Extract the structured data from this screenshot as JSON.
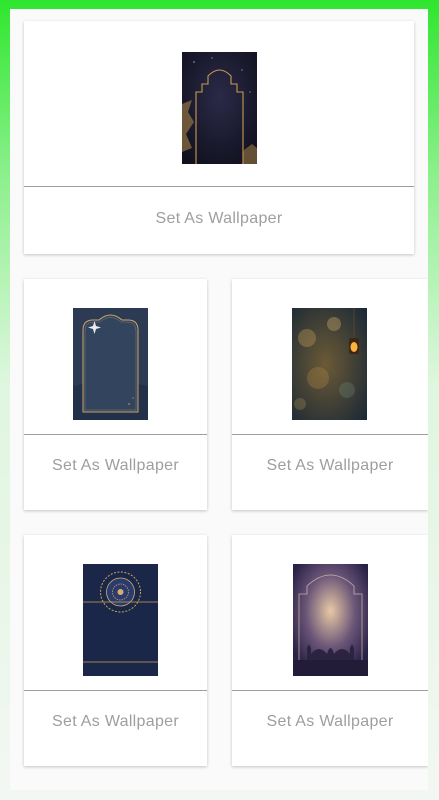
{
  "screen": {
    "accent": "#2fe62f"
  },
  "cards": [
    {
      "button_label": "Set As Wallpaper",
      "image": "golden-arch-frame-wallpaper"
    },
    {
      "button_label": "Set As Wallpaper",
      "image": "navy-ornate-frame-wallpaper"
    },
    {
      "button_label": "Set As Wallpaper",
      "image": "bokeh-lantern-wallpaper"
    },
    {
      "button_label": "Set As Wallpaper",
      "image": "mandala-navy-wallpaper"
    },
    {
      "button_label": "Set As Wallpaper",
      "image": "mosque-silhouette-wallpaper"
    }
  ]
}
